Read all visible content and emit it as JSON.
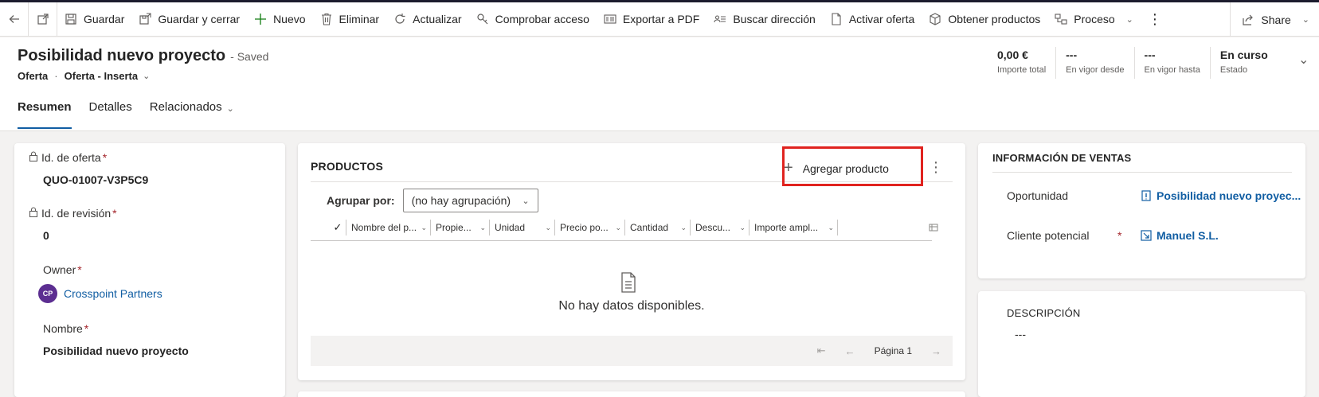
{
  "toolbar": {
    "items": [
      {
        "label": "Guardar",
        "icon": "save-icon"
      },
      {
        "label": "Guardar y cerrar",
        "icon": "save-close-icon"
      },
      {
        "label": "Nuevo",
        "icon": "plus-icon"
      },
      {
        "label": "Eliminar",
        "icon": "trash-icon"
      },
      {
        "label": "Actualizar",
        "icon": "refresh-icon"
      },
      {
        "label": "Comprobar acceso",
        "icon": "key-icon"
      },
      {
        "label": "Exportar a PDF",
        "icon": "pdf-icon"
      },
      {
        "label": "Buscar dirección",
        "icon": "contact-card-icon"
      },
      {
        "label": "Activar oferta",
        "icon": "document-icon"
      },
      {
        "label": "Obtener productos",
        "icon": "box-icon"
      },
      {
        "label": "Proceso",
        "icon": "flow-icon"
      }
    ],
    "share_label": "Share"
  },
  "header": {
    "title": "Posibilidad nuevo proyecto",
    "saved": "- Saved",
    "entity": "Oferta",
    "form": "Oferta - Inserta",
    "kpis": [
      {
        "value": "0,00 €",
        "label": "Importe total"
      },
      {
        "value": "---",
        "label": "En vigor desde"
      },
      {
        "value": "---",
        "label": "En vigor hasta"
      },
      {
        "value": "En curso",
        "label": "Estado"
      }
    ]
  },
  "tabs": {
    "resumen": "Resumen",
    "detalles": "Detalles",
    "relacionados": "Relacionados"
  },
  "left_form": {
    "quote_id_label": "Id. de oferta",
    "quote_id_value": "QUO-01007-V3P5C9",
    "revision_label": "Id. de revisión",
    "revision_value": "0",
    "owner_label": "Owner",
    "owner_initials": "CP",
    "owner_value": "Crosspoint Partners",
    "name_label": "Nombre",
    "name_value": "Posibilidad nuevo proyecto",
    "required_mark": "*"
  },
  "products": {
    "title": "PRODUCTOS",
    "add_label": "Agregar producto",
    "group_label": "Agrupar por:",
    "group_value": "(no hay agrupación)",
    "columns": [
      "Nombre del p...",
      "Propie...",
      "Unidad",
      "Precio po...",
      "Cantidad",
      "Descu...",
      "Importe ampl..."
    ],
    "empty_text": "No hay datos disponibles.",
    "page_label": "Página 1"
  },
  "sales_info": {
    "title": "INFORMACIÓN DE VENTAS",
    "opportunity_label": "Oportunidad",
    "opportunity_value": "Posibilidad nuevo proyec...",
    "lead_label": "Cliente potencial",
    "lead_value": "Manuel S.L.",
    "required_mark": "*"
  },
  "description": {
    "title": "DESCRIPCIÓN",
    "value": "---"
  }
}
